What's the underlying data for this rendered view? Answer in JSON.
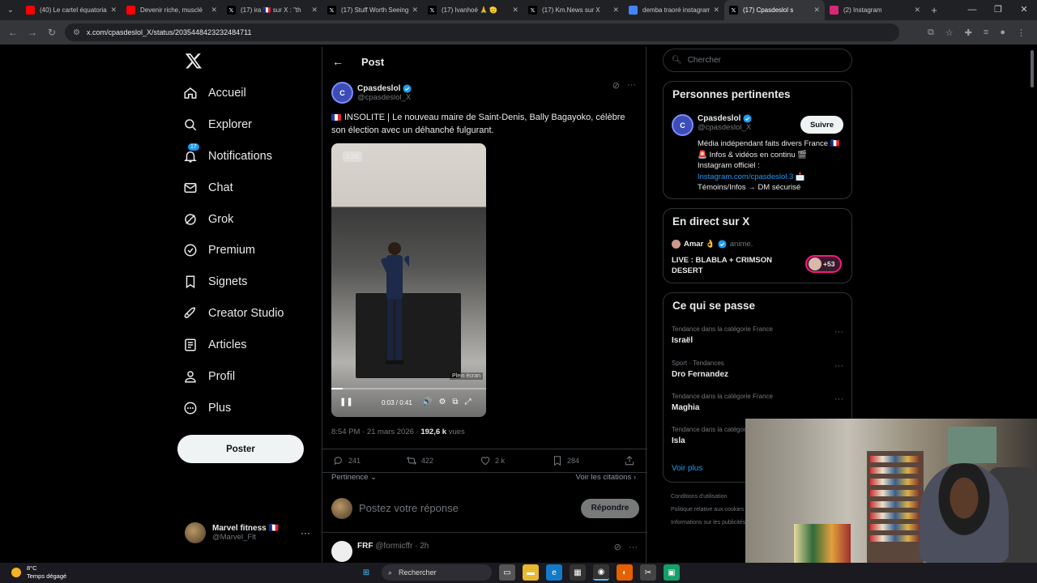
{
  "browser": {
    "tabs": [
      {
        "title": "(40) Le cartel équatorial",
        "favicon": "youtube-icon",
        "color": "#ff0000"
      },
      {
        "title": "Devenir riche, musclé",
        "favicon": "youtube-icon",
        "color": "#ff0000"
      },
      {
        "title": "(17) ira 🇫🇷 sur X : \"th",
        "favicon": "x-icon",
        "color": "#000000"
      },
      {
        "title": "(17) Stuff Worth Seeing",
        "favicon": "x-icon",
        "color": "#000000"
      },
      {
        "title": "(17) Ivanhoé 🙏 🫡",
        "favicon": "x-icon",
        "color": "#000000"
      },
      {
        "title": "(17) Km.News sur X",
        "favicon": "x-icon",
        "color": "#000000"
      },
      {
        "title": "demba traoré instagram",
        "favicon": "google-icon",
        "color": "#4285f4"
      },
      {
        "title": "(17) Cpasdeslol s",
        "favicon": "x-icon",
        "color": "#000000",
        "active": true
      },
      {
        "title": "(2) Instagram",
        "favicon": "instagram-icon",
        "color": "#d62976"
      }
    ],
    "url": "x.com/cpasdeslol_X/status/2035448423232484711"
  },
  "nav": {
    "items": [
      {
        "label": "Accueil",
        "icon": "home-icon"
      },
      {
        "label": "Explorer",
        "icon": "search-icon"
      },
      {
        "label": "Notifications",
        "icon": "bell-icon",
        "badge": "17"
      },
      {
        "label": "Chat",
        "icon": "mail-icon"
      },
      {
        "label": "Grok",
        "icon": "grok-icon"
      },
      {
        "label": "Premium",
        "icon": "premium-icon"
      },
      {
        "label": "Signets",
        "icon": "bookmark-icon"
      },
      {
        "label": "Creator Studio",
        "icon": "rocket-icon"
      },
      {
        "label": "Articles",
        "icon": "article-icon"
      },
      {
        "label": "Profil",
        "icon": "person-icon"
      },
      {
        "label": "Plus",
        "icon": "more-circle-icon"
      }
    ],
    "post_button": "Poster",
    "me": {
      "name": "Marvel fitness 🇫🇷",
      "handle": "@Marvel_Flt"
    }
  },
  "post": {
    "header": "Post",
    "author": {
      "name": "Cpasdeslol",
      "handle": "@cpasdeslol_X",
      "avatar_text": "C"
    },
    "text": "INSOLITE | Le nouveau maire de Saint-Denis, Bally Bagayoko, célèbre son élection avec un déhanché fulgurant.",
    "video": {
      "speed": "1.00",
      "tooltip": "Plein écran",
      "time": "0:03 / 0:41",
      "progress": 0.073
    },
    "time": "8:54 PM · 21 mars 2026 · ",
    "views": "192,6 k",
    "views_label": " vues",
    "stats": {
      "replies": "241",
      "reposts": "422",
      "likes": "2 k",
      "bookmarks": "284"
    },
    "sort": "Pertinence ⌄",
    "quotes_link": "Voir les citations ›",
    "reply_placeholder": "Postez votre réponse",
    "reply_button": "Répondre",
    "next_reply": {
      "name": "FRF",
      "handle": "@formicffr · 2h"
    }
  },
  "right": {
    "search_placeholder": "Chercher",
    "related": {
      "title": "Personnes pertinentes",
      "name": "Cpasdeslol",
      "handle": "@cpasdeslol_X",
      "follow": "Suivre",
      "bio_line1": "Média indépendant faits divers France 🇫🇷 🚨 Infos & vidéos en continu 🎬",
      "bio_line2": "Instagram officiel :",
      "bio_link": "Instagram.com/cpasdeslol.3",
      "bio_line3": "Témoins/Infos → DM sécurisé"
    },
    "live": {
      "title": "En direct sur X",
      "host": "Amar 👌",
      "host_role": "anime.",
      "stream": "LIVE : BLABLA + CRIMSON DESERT",
      "listeners": "+53"
    },
    "trends": {
      "title": "Ce qui se passe",
      "items": [
        {
          "context": "Tendance dans la catégorie France",
          "name": "Israël"
        },
        {
          "context": "Sport · Tendances",
          "name": "Dro Fernandez"
        },
        {
          "context": "Tendance dans la catégorie France",
          "name": "Maghia"
        },
        {
          "context": "Tendance dans la catégorie France",
          "name": "Isla"
        }
      ],
      "more": "Voir plus"
    },
    "footer": [
      "Conditions d'utilisation",
      "Politique relative aux cookies",
      "Informations sur les publicités"
    ]
  },
  "taskbar": {
    "temp": "8°C",
    "weather": "Temps dégagé",
    "search": "Rechercher"
  }
}
